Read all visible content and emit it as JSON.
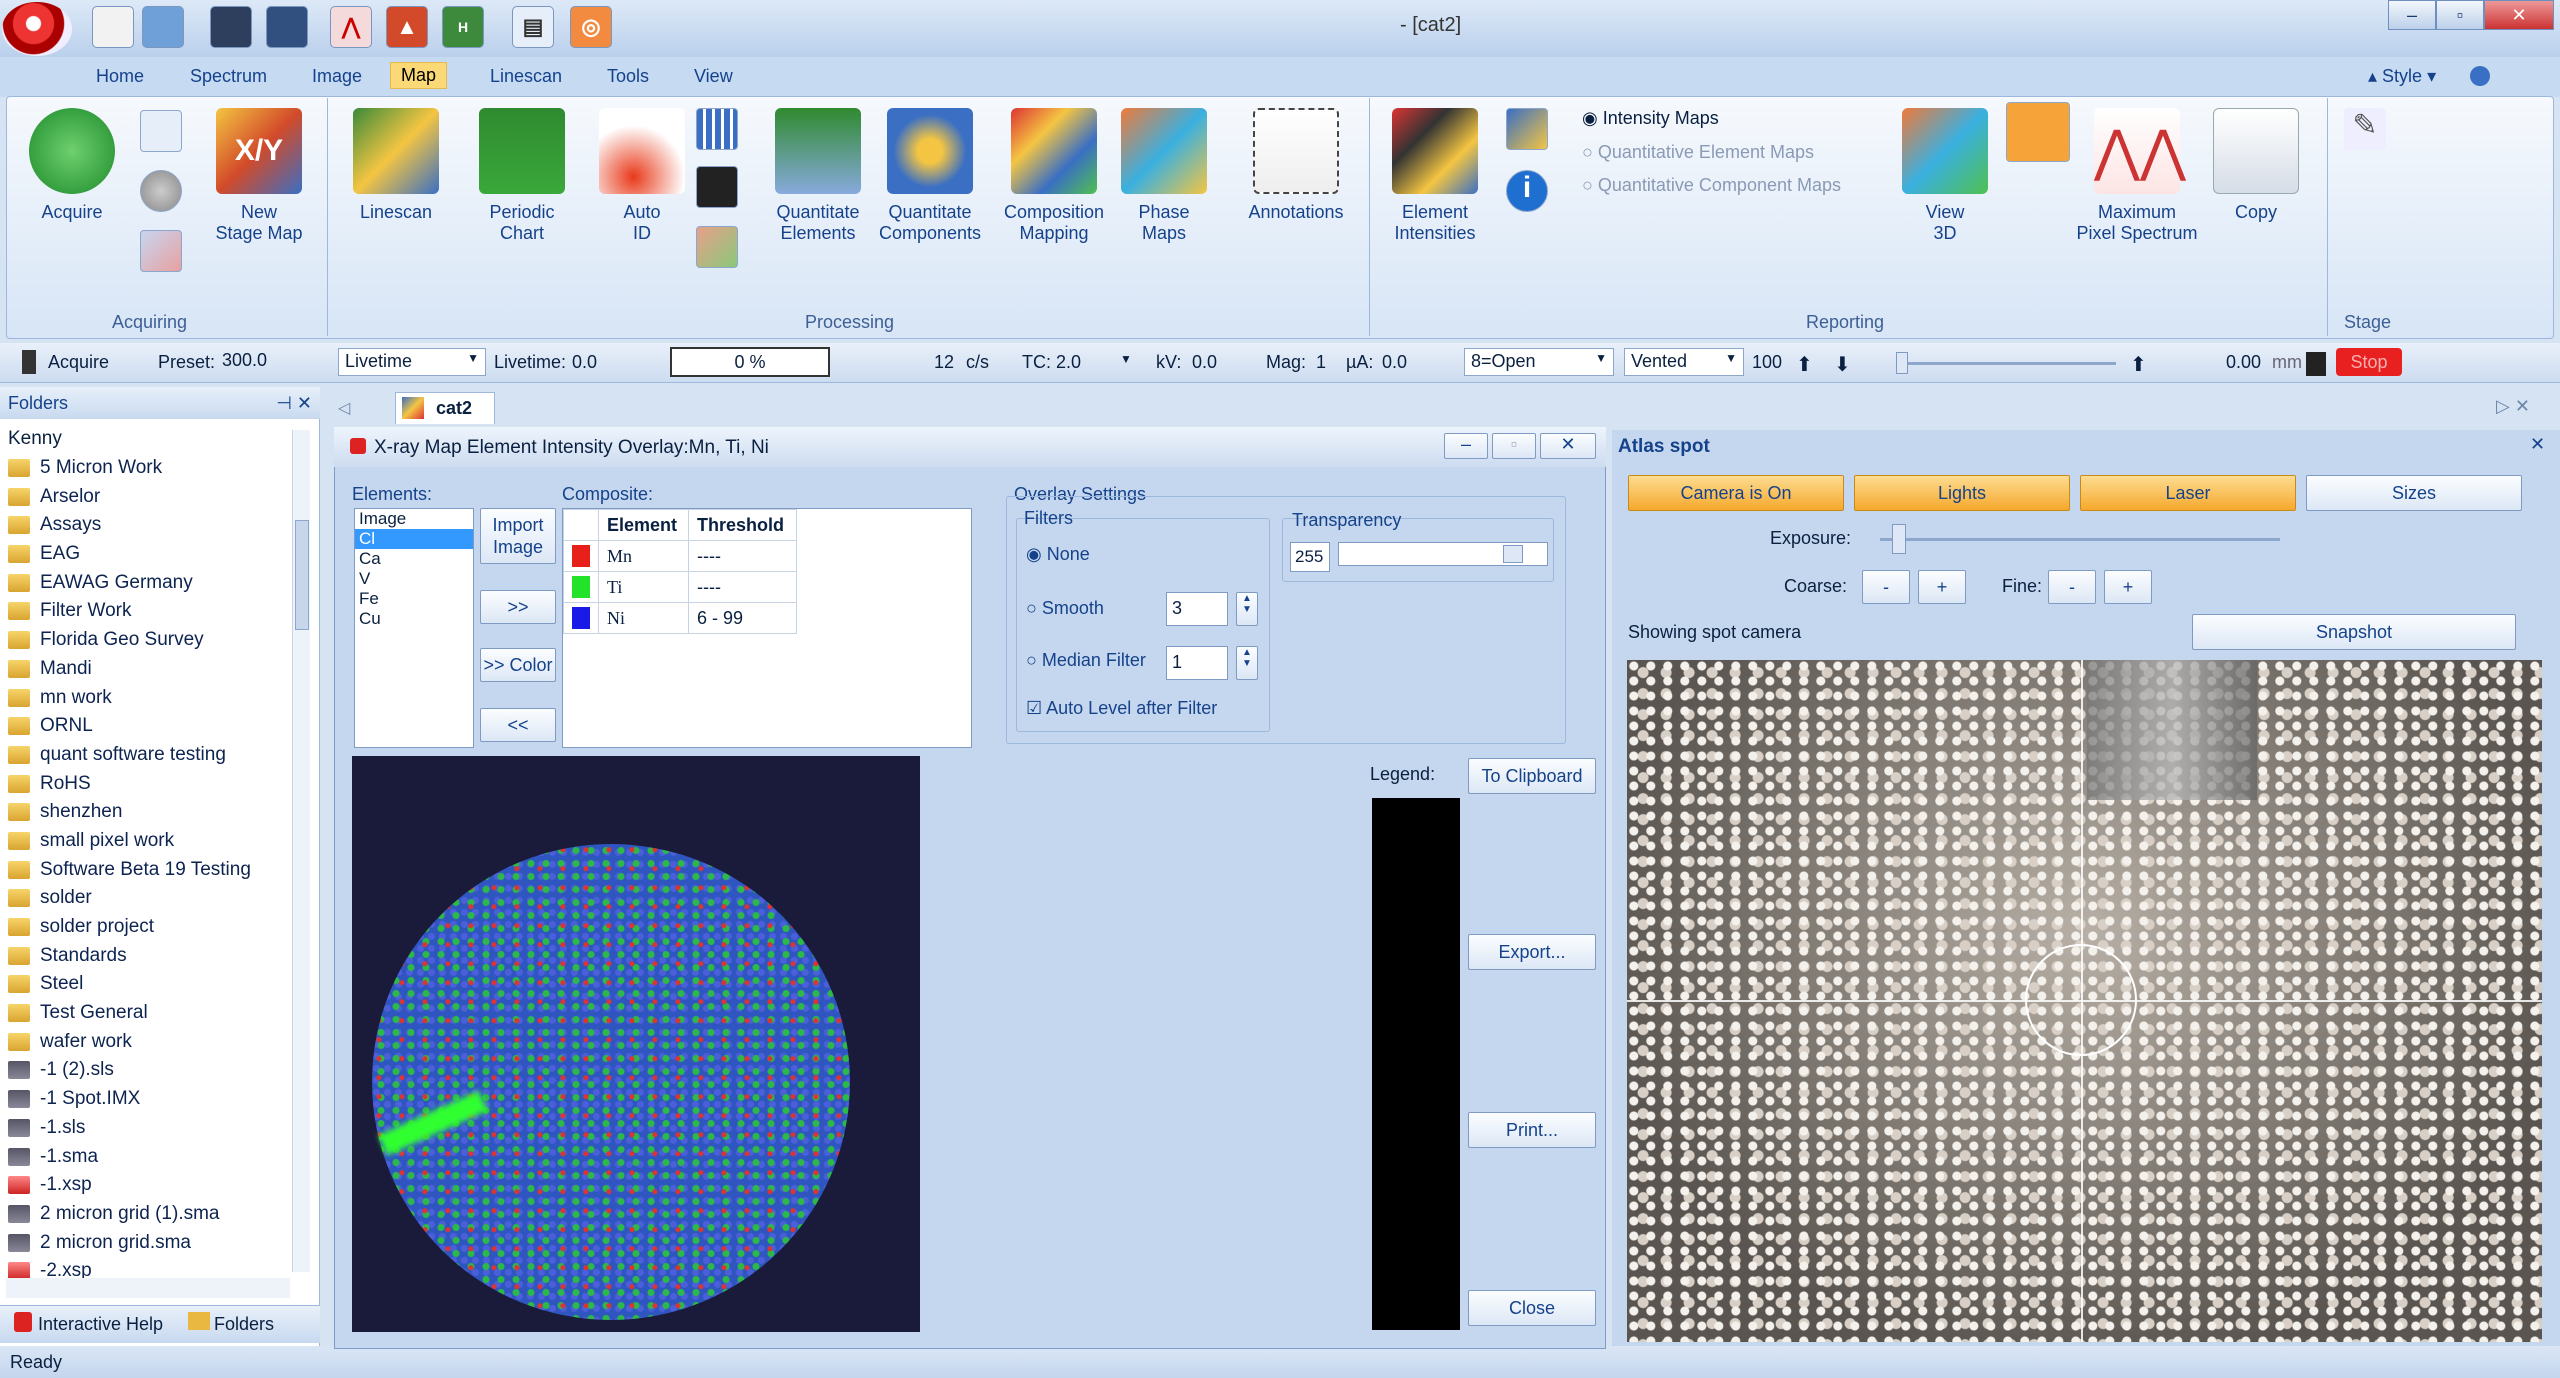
{
  "window": {
    "title": "- [cat2]"
  },
  "menu_tabs": [
    "Home",
    "Spectrum",
    "Image",
    "Map",
    "Linescan",
    "Tools",
    "View"
  ],
  "active_tab": "Map",
  "style_label": "Style",
  "ribbon": {
    "acquiring": {
      "label": "Acquiring",
      "acquire": "Acquire",
      "new_stage_map": [
        "New",
        "Stage Map"
      ]
    },
    "processing": {
      "label": "Processing",
      "items": [
        [
          "Linescan",
          ""
        ],
        [
          "Periodic",
          "Chart"
        ],
        [
          "Auto",
          "ID"
        ],
        [
          "Quantitate",
          "Elements"
        ],
        [
          "Quantitate",
          "Components"
        ],
        [
          "Composition",
          "Mapping"
        ],
        [
          "Phase",
          "Maps"
        ],
        [
          "Annotations",
          ""
        ]
      ]
    },
    "reporting": {
      "label": "Reporting",
      "element_intensities": [
        "Element",
        "Intensities"
      ],
      "radios": [
        "Intensity Maps",
        "Quantitative Element Maps",
        "Quantitative Component Maps"
      ],
      "view3d": [
        "View",
        "3D"
      ],
      "max_pixel": [
        "Maximum",
        "Pixel Spectrum"
      ],
      "copy": "Copy"
    },
    "stage": {
      "label": "Stage"
    }
  },
  "statusbar": {
    "acquire": "Acquire",
    "preset_label": "Preset:",
    "preset": "300.0",
    "livetime_sel": "Livetime",
    "livetime_label": "Livetime:",
    "livetime": "0.0",
    "progress": "0 %",
    "progress_value": 0,
    "cps": "12",
    "cps_unit": "c/s",
    "tc_label": "TC:",
    "tc": "2.0",
    "kv_label": "kV:",
    "kv": "0.0",
    "mag_label": "Mag:",
    "mag": "1",
    "ua_label": "µA:",
    "ua": "0.0",
    "aperture": "8=Open",
    "vacuum": "Vented",
    "speed": "100",
    "pos": "0.00",
    "pos_unit": "mm",
    "stop": "Stop"
  },
  "folders": {
    "title": "Folders",
    "root": "Kenny",
    "items": [
      {
        "name": "5 Micron Work",
        "t": "d"
      },
      {
        "name": "Arselor",
        "t": "d"
      },
      {
        "name": "Assays",
        "t": "d"
      },
      {
        "name": "EAG",
        "t": "d"
      },
      {
        "name": "EAWAG Germany",
        "t": "d"
      },
      {
        "name": "Filter Work",
        "t": "d"
      },
      {
        "name": "Florida Geo Survey",
        "t": "d"
      },
      {
        "name": "Mandi",
        "t": "d"
      },
      {
        "name": "mn work",
        "t": "d"
      },
      {
        "name": "ORNL",
        "t": "d"
      },
      {
        "name": "quant software testing",
        "t": "d"
      },
      {
        "name": "RoHS",
        "t": "d"
      },
      {
        "name": "shenzhen",
        "t": "d"
      },
      {
        "name": "small pixel work",
        "t": "d"
      },
      {
        "name": "Software Beta 19 Testing",
        "t": "d"
      },
      {
        "name": "solder",
        "t": "d"
      },
      {
        "name": "solder project",
        "t": "d"
      },
      {
        "name": "Standards",
        "t": "d"
      },
      {
        "name": "Steel",
        "t": "d"
      },
      {
        "name": "Test General",
        "t": "d"
      },
      {
        "name": "wafer work",
        "t": "d"
      },
      {
        "name": "-1 (2).sls",
        "t": "f"
      },
      {
        "name": "-1 Spot.IMX",
        "t": "f"
      },
      {
        "name": "-1.sls",
        "t": "f"
      },
      {
        "name": "-1.sma",
        "t": "f"
      },
      {
        "name": "-1.xsp",
        "t": "r"
      },
      {
        "name": "2 micron grid (1).sma",
        "t": "f"
      },
      {
        "name": "2 micron grid.sma",
        "t": "f"
      },
      {
        "name": "-2.xsp",
        "t": "r"
      }
    ]
  },
  "bottom_tabs": {
    "help": "Interactive Help",
    "folders": "Folders"
  },
  "status": "Ready",
  "doc_tab": "cat2",
  "dialog": {
    "title": "X-ray Map Element Intensity Overlay:Mn, Ti, Ni",
    "elements_label": "Elements:",
    "elements": [
      "Image",
      "Cl",
      "Ca",
      "V",
      "Fe",
      "Cu"
    ],
    "selected": "Cl",
    "import_image": [
      "Import",
      "Image"
    ],
    "add": ">>",
    "add_color": ">> Color",
    "remove": "<<",
    "composite_label": "Composite:",
    "col_element": "Element",
    "col_threshold": "Threshold",
    "rows": [
      {
        "el": "Mn",
        "th": "----",
        "color": "#e8201c"
      },
      {
        "el": "Ti",
        "th": "----",
        "color": "#22e22a"
      },
      {
        "el": "Ni",
        "th": "6 - 99",
        "color": "#1a1ae8"
      }
    ],
    "overlay_label": "Overlay Settings",
    "filters_label": "Filters",
    "none": "None",
    "smooth": "Smooth",
    "smooth_val": "3",
    "median": "Median Filter",
    "median_val": "1",
    "auto_level": "Auto Level after Filter",
    "transparency_label": "Transparency",
    "transparency": "255",
    "legend_label": "Legend:",
    "clipboard": "To Clipboard",
    "export": "Export...",
    "print": "Print...",
    "close": "Close"
  },
  "atlas": {
    "title": "Atlas spot",
    "camera": "Camera is On",
    "lights": "Lights",
    "laser": "Laser",
    "sizes": "Sizes",
    "exposure": "Exposure:",
    "coarse": "Coarse:",
    "fine": "Fine:",
    "minus": "-",
    "plus": "+",
    "showing": "Showing spot camera",
    "snapshot": "Snapshot"
  }
}
